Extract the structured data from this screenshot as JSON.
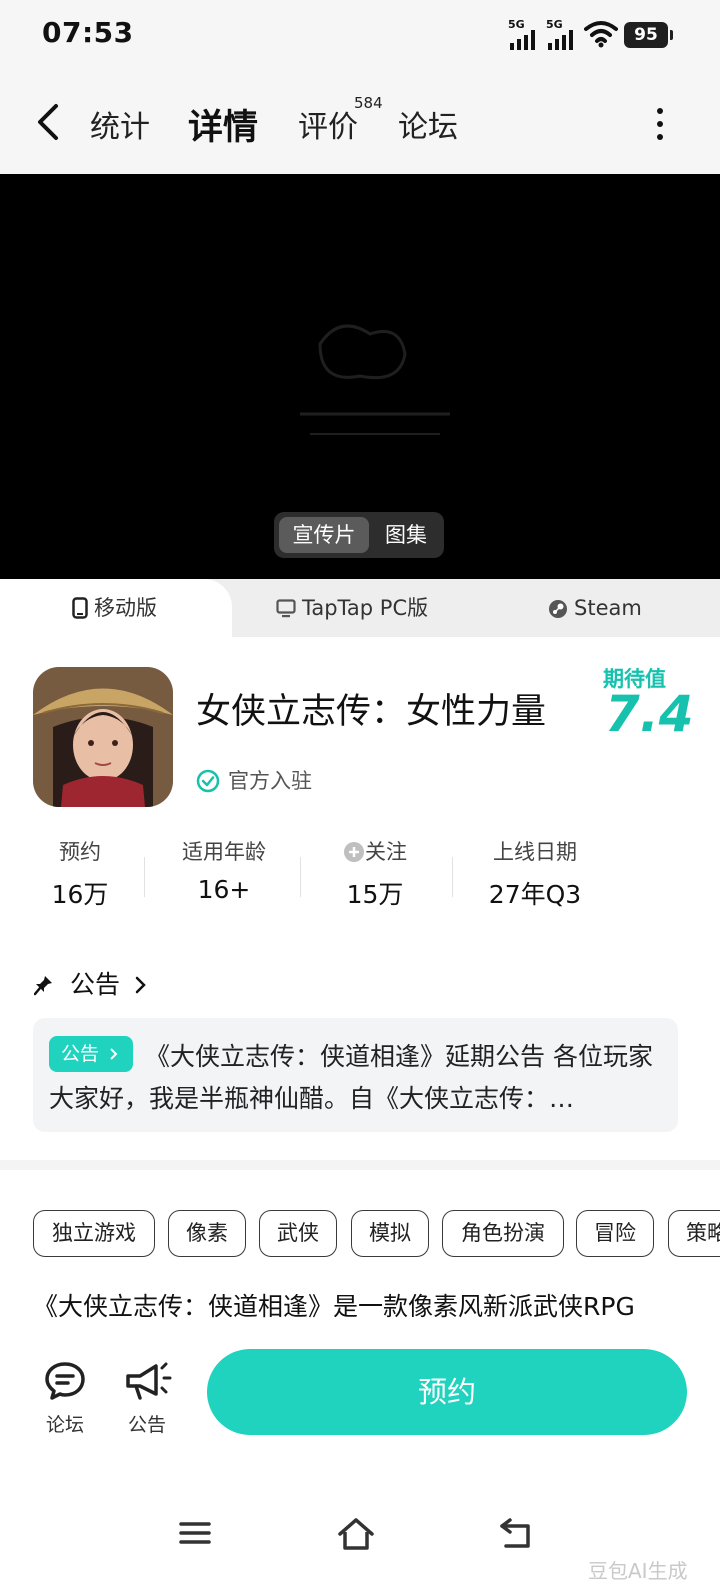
{
  "status_bar": {
    "time": "07:53",
    "signal1_label": "5G",
    "signal2_label": "5G",
    "battery": "95",
    "icons": [
      "signal-icon",
      "signal-icon",
      "wifi-icon",
      "battery-icon"
    ]
  },
  "nav": {
    "tabs": [
      {
        "label": "统计"
      },
      {
        "label": "详情"
      },
      {
        "label": "评价"
      },
      {
        "label": "论坛"
      }
    ],
    "reviews_count": "584",
    "active_tab": "详情"
  },
  "media": {
    "toggle_options": [
      "宣传片",
      "图集"
    ],
    "selected": "宣传片"
  },
  "platforms": {
    "tabs": [
      {
        "label": "移动版",
        "icon": "phone-icon"
      },
      {
        "label": "TapTap PC版",
        "icon": "monitor-icon"
      },
      {
        "label": "Steam",
        "icon": "steam-icon"
      }
    ],
    "selected": "移动版"
  },
  "game": {
    "title": "女侠立志传：女性力量",
    "verified": "官方入驻",
    "expectation_label": "期待值",
    "expectation_value": "7.4"
  },
  "stats": [
    {
      "label": "预约",
      "value": "16万"
    },
    {
      "label": "适用年龄",
      "value": "16+"
    },
    {
      "label": "关注",
      "value": "15万"
    },
    {
      "label": "上线日期",
      "value": "27年Q3"
    }
  ],
  "announcement": {
    "heading": "公告",
    "pill": "公告",
    "text": "《大侠立志传：侠道相逢》延期公告 各位玩家大家好，我是半瓶神仙醋。自《大侠立志传：…"
  },
  "tags": [
    "独立游戏",
    "像素",
    "武侠",
    "模拟",
    "角色扮演",
    "冒险",
    "策略"
  ],
  "description": "《大侠立志传：侠道相逢》是一款像素风新派武侠RPG",
  "bottom_bar": {
    "forum_label": "论坛",
    "notice_label": "公告",
    "reserve_label": "预约"
  },
  "watermark": "豆包AI生成",
  "colors": {
    "accent": "#1fd3bf",
    "accent_text": "#16c2ae",
    "video_bg": "#000000"
  }
}
